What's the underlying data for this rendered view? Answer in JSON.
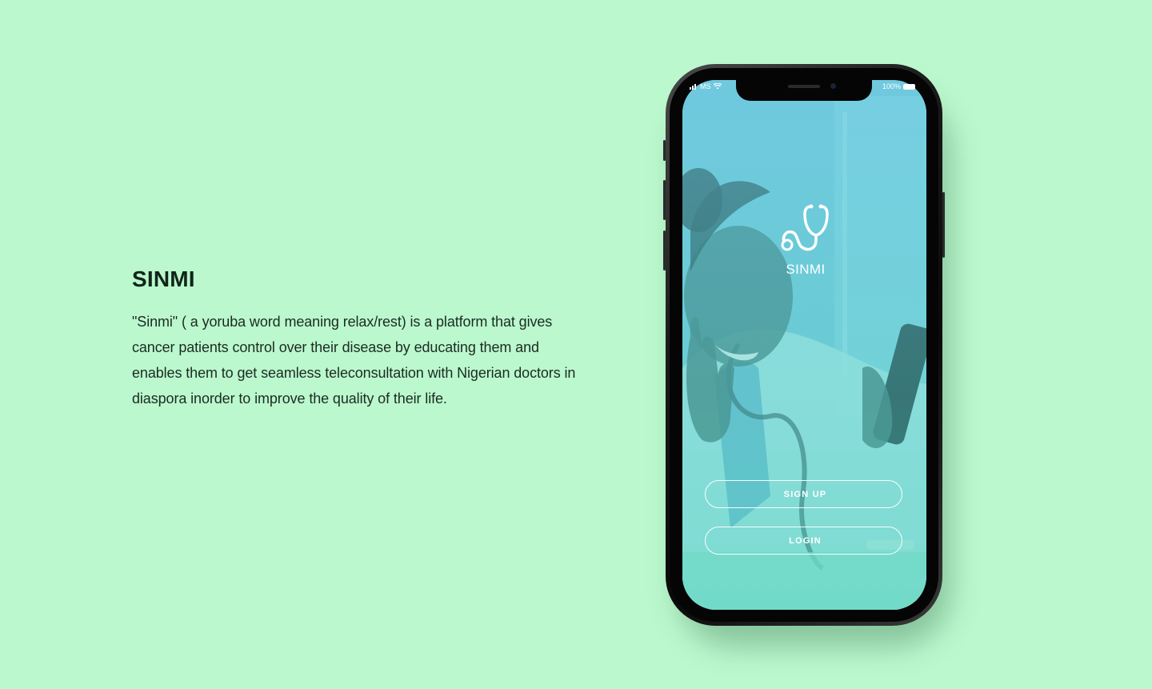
{
  "intro": {
    "title": "SINMI",
    "description": "\"Sinmi\" ( a yoruba word meaning relax/rest) is a platform that gives cancer patients control over their disease by educating them and enables them to get seamless teleconsultation with Nigerian doctors in diaspora inorder to improve the quality of their life."
  },
  "phone": {
    "status_bar": {
      "carrier": "MS",
      "battery": "100%"
    },
    "app": {
      "logo_icon": "stethoscope-icon",
      "name": "SINMI",
      "signup_label": "SIGN UP",
      "login_label": "LOGIN"
    }
  },
  "colors": {
    "page_background": "#bbf8cd",
    "screen_overlay": "#5fd0c8",
    "text_dark": "#10251a"
  }
}
